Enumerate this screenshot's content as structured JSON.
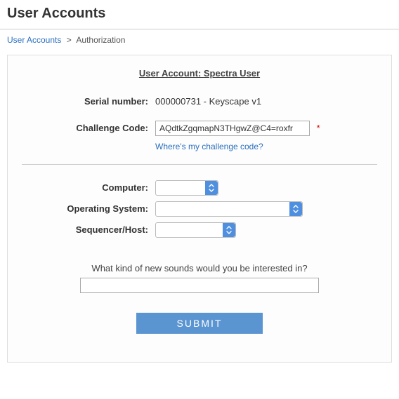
{
  "page_title": "User Accounts",
  "breadcrumb": {
    "root": "User Accounts",
    "sep": ">",
    "current": "Authorization"
  },
  "section_title": "User Account: Spectra User",
  "labels": {
    "serial": "Serial number:",
    "challenge": "Challenge Code:",
    "computer": "Computer:",
    "os": "Operating System:",
    "sequencer": "Sequencer/Host:"
  },
  "serial_value": "000000731 - Keyscape v1",
  "challenge_value": "AQdtkZgqmapN3THgwZ@C4=roxfr",
  "help_link": "Where's my challenge code?",
  "required_mark": "*",
  "computer_selected": "",
  "os_selected": "",
  "sequencer_selected": "",
  "question": "What kind of new sounds would you be interested in?",
  "sounds_value": "",
  "submit_label": "SUBMIT"
}
